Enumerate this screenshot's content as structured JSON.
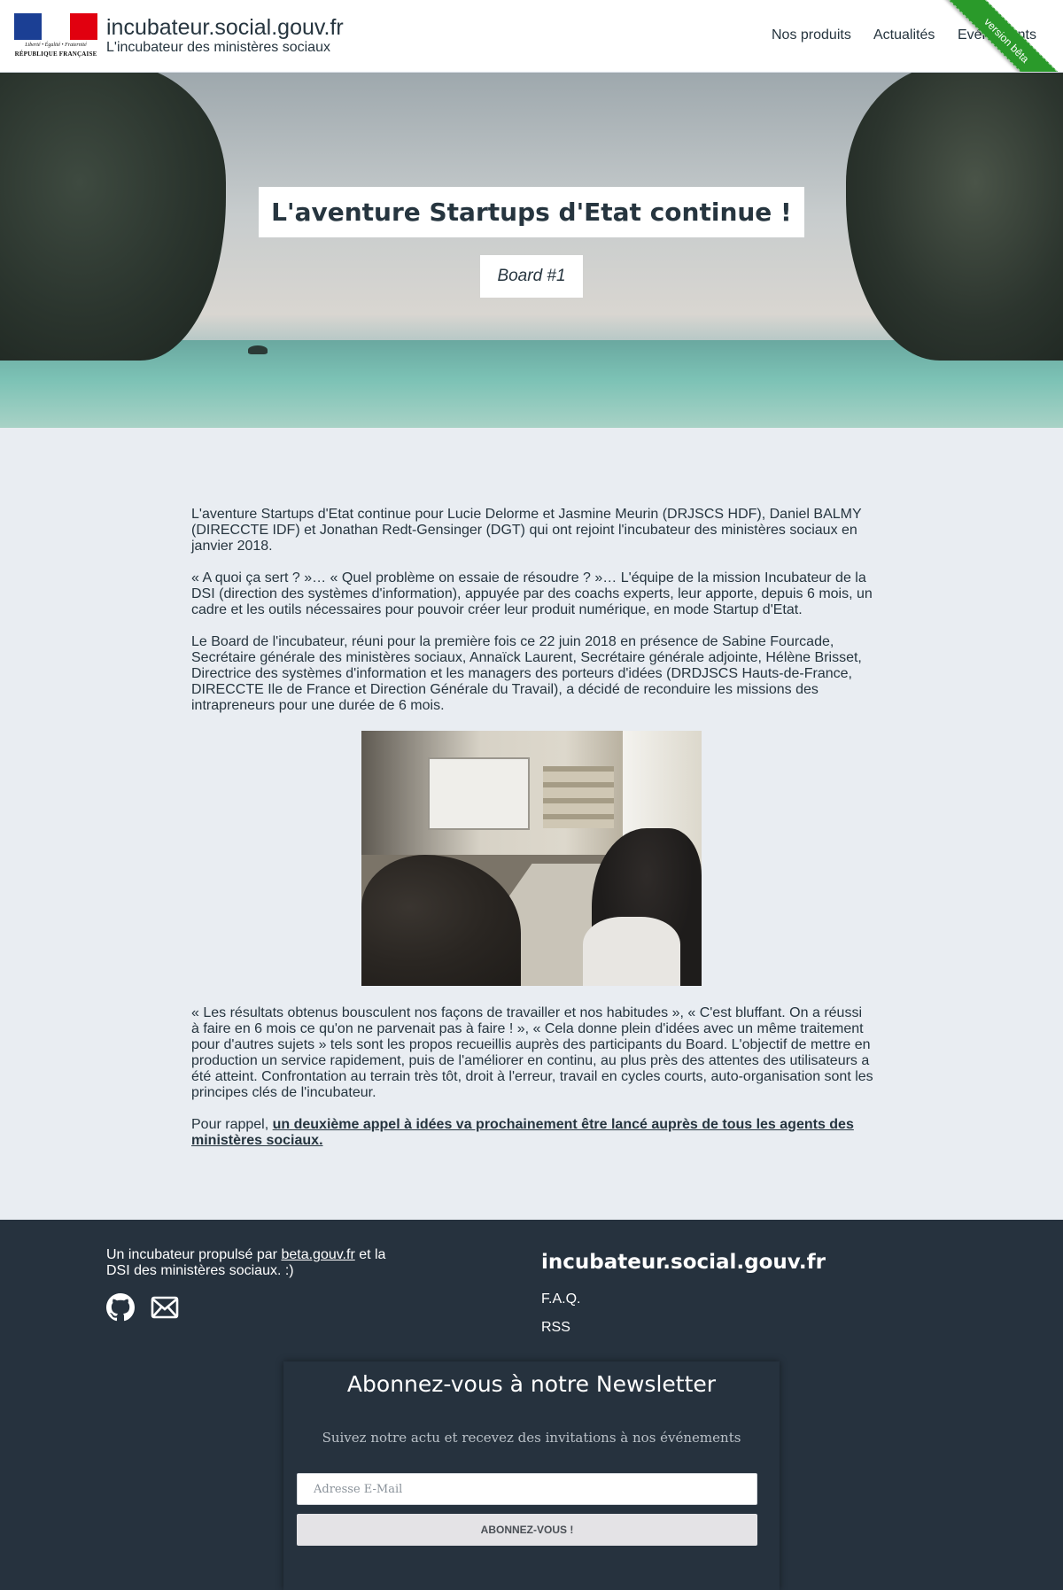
{
  "header": {
    "logo": {
      "colors": {
        "blue": "#1b3f94",
        "white": "#ffffff",
        "red": "#e1000f"
      },
      "devise": "Liberté • Égalité • Fraternité",
      "republique": "RÉPUBLIQUE FRANÇAISE"
    },
    "site_title": "incubateur.social.gouv.fr",
    "site_subtitle": "L'incubateur des ministères sociaux",
    "nav": [
      "Nos produits",
      "Actualités",
      "Evénements"
    ],
    "ribbon": "version bêta",
    "ribbon_color": "#2a9a2a"
  },
  "hero": {
    "title": "L'aventure Startups d'Etat continue !",
    "subtitle": "Board #1"
  },
  "article": {
    "paragraphs": [
      "L'aventure Startups d'Etat continue pour Lucie Delorme et Jasmine Meurin (DRJSCS HDF), Daniel BALMY (DIRECCTE IDF) et Jonathan Redt-Gensinger (DGT) qui ont rejoint l'incubateur des ministères sociaux en janvier 2018.",
      "« A quoi ça sert ? »… « Quel problème on essaie de résoudre ? »… L'équipe de la mission Incubateur de la DSI (direction des systèmes d'information), appuyée par des coachs experts, leur apporte, depuis 6 mois, un cadre et les outils nécessaires pour pouvoir créer leur produit numérique, en mode Startup d'Etat.",
      "Le Board de l'incubateur, réuni pour la première fois ce 22 juin 2018 en présence de Sabine Fourcade, Secrétaire générale des ministères sociaux, Annaïck Laurent, Secrétaire générale adjointe, Hélène Brisset, Directrice des systèmes d'information et les managers des porteurs d'idées (DRDJSCS Hauts-de-France, DIRECCTE Ile de France et Direction Générale du Travail), a décidé de reconduire les missions des intrapreneurs pour une durée de 6 mois."
    ],
    "paragraph_after_photo": "« Les résultats obtenus bousculent nos façons de travailler et nos habitudes », « C'est bluffant. On a réussi à faire en 6 mois ce qu'on ne parvenait pas à faire ! », « Cela donne plein d'idées avec un même traitement pour d'autres sujets » tels sont les propos recueillis auprès des participants du Board. L'objectif de mettre en production un service rapidement, puis de l'améliorer en continu, au plus près des attentes des utilisateurs a été atteint. Confrontation au terrain très tôt, droit à l'erreur, travail en cycles courts, auto-organisation sont les principes clés de l'incubateur.",
    "reminder_prefix": "Pour rappel, ",
    "reminder_link": "un deuxième appel à idées va prochainement être lancé auprès de tous les agents des ministères sociaux."
  },
  "footer": {
    "propulse_prefix": "Un incubateur propulsé par ",
    "propulse_link": "beta.gouv.fr",
    "propulse_suffix": " et la DSI des ministères sociaux. :)",
    "brand": "incubateur.social.gouv.fr",
    "links": [
      "F.A.Q.",
      "RSS"
    ],
    "icons": [
      "github-icon",
      "mail-icon"
    ]
  },
  "newsletter": {
    "title": "Abonnez-vous à notre Newsletter",
    "subtitle": "Suivez notre actu et recevez des invitations à nos événements",
    "email_placeholder": "Adresse E-Mail",
    "email_value": "",
    "button_label": "ABONNEZ-VOUS !"
  },
  "colors": {
    "text": "#26353f",
    "page_background": "#e9edf2",
    "footer_background": "#26323e"
  }
}
